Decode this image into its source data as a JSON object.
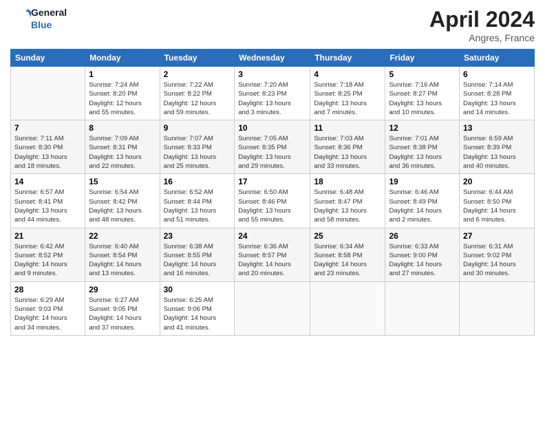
{
  "header": {
    "logo_line1": "General",
    "logo_line2": "Blue",
    "month": "April 2024",
    "location": "Angres, France"
  },
  "days_of_week": [
    "Sunday",
    "Monday",
    "Tuesday",
    "Wednesday",
    "Thursday",
    "Friday",
    "Saturday"
  ],
  "weeks": [
    [
      {
        "day": "",
        "info": ""
      },
      {
        "day": "1",
        "info": "Sunrise: 7:24 AM\nSunset: 8:20 PM\nDaylight: 12 hours\nand 55 minutes."
      },
      {
        "day": "2",
        "info": "Sunrise: 7:22 AM\nSunset: 8:22 PM\nDaylight: 12 hours\nand 59 minutes."
      },
      {
        "day": "3",
        "info": "Sunrise: 7:20 AM\nSunset: 8:23 PM\nDaylight: 13 hours\nand 3 minutes."
      },
      {
        "day": "4",
        "info": "Sunrise: 7:18 AM\nSunset: 8:25 PM\nDaylight: 13 hours\nand 7 minutes."
      },
      {
        "day": "5",
        "info": "Sunrise: 7:16 AM\nSunset: 8:27 PM\nDaylight: 13 hours\nand 10 minutes."
      },
      {
        "day": "6",
        "info": "Sunrise: 7:14 AM\nSunset: 8:28 PM\nDaylight: 13 hours\nand 14 minutes."
      }
    ],
    [
      {
        "day": "7",
        "info": "Sunrise: 7:11 AM\nSunset: 8:30 PM\nDaylight: 13 hours\nand 18 minutes."
      },
      {
        "day": "8",
        "info": "Sunrise: 7:09 AM\nSunset: 8:31 PM\nDaylight: 13 hours\nand 22 minutes."
      },
      {
        "day": "9",
        "info": "Sunrise: 7:07 AM\nSunset: 8:33 PM\nDaylight: 13 hours\nand 25 minutes."
      },
      {
        "day": "10",
        "info": "Sunrise: 7:05 AM\nSunset: 8:35 PM\nDaylight: 13 hours\nand 29 minutes."
      },
      {
        "day": "11",
        "info": "Sunrise: 7:03 AM\nSunset: 8:36 PM\nDaylight: 13 hours\nand 33 minutes."
      },
      {
        "day": "12",
        "info": "Sunrise: 7:01 AM\nSunset: 8:38 PM\nDaylight: 13 hours\nand 36 minutes."
      },
      {
        "day": "13",
        "info": "Sunrise: 6:59 AM\nSunset: 8:39 PM\nDaylight: 13 hours\nand 40 minutes."
      }
    ],
    [
      {
        "day": "14",
        "info": "Sunrise: 6:57 AM\nSunset: 8:41 PM\nDaylight: 13 hours\nand 44 minutes."
      },
      {
        "day": "15",
        "info": "Sunrise: 6:54 AM\nSunset: 8:42 PM\nDaylight: 13 hours\nand 48 minutes."
      },
      {
        "day": "16",
        "info": "Sunrise: 6:52 AM\nSunset: 8:44 PM\nDaylight: 13 hours\nand 51 minutes."
      },
      {
        "day": "17",
        "info": "Sunrise: 6:50 AM\nSunset: 8:46 PM\nDaylight: 13 hours\nand 55 minutes."
      },
      {
        "day": "18",
        "info": "Sunrise: 6:48 AM\nSunset: 8:47 PM\nDaylight: 13 hours\nand 58 minutes."
      },
      {
        "day": "19",
        "info": "Sunrise: 6:46 AM\nSunset: 8:49 PM\nDaylight: 14 hours\nand 2 minutes."
      },
      {
        "day": "20",
        "info": "Sunrise: 6:44 AM\nSunset: 8:50 PM\nDaylight: 14 hours\nand 6 minutes."
      }
    ],
    [
      {
        "day": "21",
        "info": "Sunrise: 6:42 AM\nSunset: 8:52 PM\nDaylight: 14 hours\nand 9 minutes."
      },
      {
        "day": "22",
        "info": "Sunrise: 6:40 AM\nSunset: 8:54 PM\nDaylight: 14 hours\nand 13 minutes."
      },
      {
        "day": "23",
        "info": "Sunrise: 6:38 AM\nSunset: 8:55 PM\nDaylight: 14 hours\nand 16 minutes."
      },
      {
        "day": "24",
        "info": "Sunrise: 6:36 AM\nSunset: 8:57 PM\nDaylight: 14 hours\nand 20 minutes."
      },
      {
        "day": "25",
        "info": "Sunrise: 6:34 AM\nSunset: 8:58 PM\nDaylight: 14 hours\nand 23 minutes."
      },
      {
        "day": "26",
        "info": "Sunrise: 6:33 AM\nSunset: 9:00 PM\nDaylight: 14 hours\nand 27 minutes."
      },
      {
        "day": "27",
        "info": "Sunrise: 6:31 AM\nSunset: 9:02 PM\nDaylight: 14 hours\nand 30 minutes."
      }
    ],
    [
      {
        "day": "28",
        "info": "Sunrise: 6:29 AM\nSunset: 9:03 PM\nDaylight: 14 hours\nand 34 minutes."
      },
      {
        "day": "29",
        "info": "Sunrise: 6:27 AM\nSunset: 9:05 PM\nDaylight: 14 hours\nand 37 minutes."
      },
      {
        "day": "30",
        "info": "Sunrise: 6:25 AM\nSunset: 9:06 PM\nDaylight: 14 hours\nand 41 minutes."
      },
      {
        "day": "",
        "info": ""
      },
      {
        "day": "",
        "info": ""
      },
      {
        "day": "",
        "info": ""
      },
      {
        "day": "",
        "info": ""
      }
    ]
  ]
}
